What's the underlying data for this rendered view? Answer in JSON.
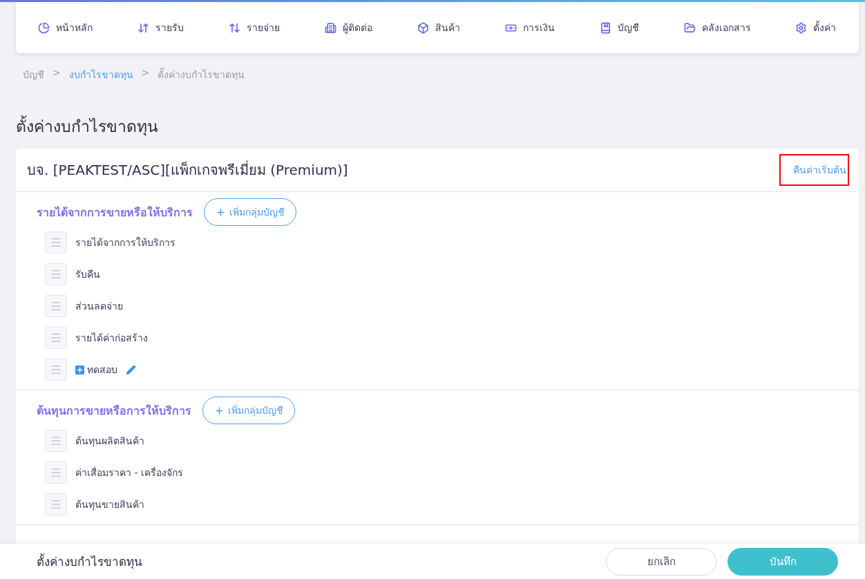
{
  "nav": [
    {
      "label": "หน้าหลัก"
    },
    {
      "label": "รายรับ"
    },
    {
      "label": "รายจ่าย"
    },
    {
      "label": "ผู้ติดต่อ"
    },
    {
      "label": "สินค้า"
    },
    {
      "label": "การเงิน"
    },
    {
      "label": "บัญชี"
    },
    {
      "label": "คลังเอกสาร"
    },
    {
      "label": "ตั้งค่า"
    }
  ],
  "breadcrumb": [
    {
      "label": "บัญชี",
      "link": false
    },
    {
      "label": "งบกำไรขาดทุน",
      "link": true
    },
    {
      "label": "ตั้งค่างบกำไรขาดทุน",
      "link": false
    }
  ],
  "breadcrumb_separator": ">",
  "page_title": "ตั้งค่างบกำไรขาดทุน",
  "card": {
    "title": "บจ. [PEAKTEST/ASC][แพ็กเกจพรีเมี่ยม (Premium)]",
    "reset_link": {
      "label": "คืนค่าเริ่มต้น",
      "highlighted": true
    },
    "groups": [
      {
        "title": "รายได้จากการขายหรือให้บริการ",
        "add_button": "เพิ่มกลุ่มบัญชี",
        "items": [
          {
            "label": "รายได้จากการให้บริการ",
            "custom": false
          },
          {
            "label": "รับคืน",
            "custom": false
          },
          {
            "label": "ส่วนลดจ่าย",
            "custom": false
          },
          {
            "label": "รายได้ค่าก่อสร้าง",
            "custom": false
          },
          {
            "label": "ทดสอบ",
            "custom": true
          }
        ]
      },
      {
        "title": "ต้นทุนการขายหรือการให้บริการ",
        "add_button": "เพิ่มกลุ่มบัญชี",
        "items": [
          {
            "label": "ต้นทุนผลิตสินค้า",
            "custom": false
          },
          {
            "label": "ค่าเสื่อมราคา - เครื่องจักร",
            "custom": false
          },
          {
            "label": "ต้นทุนขายสินค้า",
            "custom": false
          }
        ]
      }
    ]
  },
  "footer": {
    "title": "ตั้งค่างบกำไรขาดทุน",
    "cancel": "ยกเลิก",
    "save": "บันทึก"
  }
}
